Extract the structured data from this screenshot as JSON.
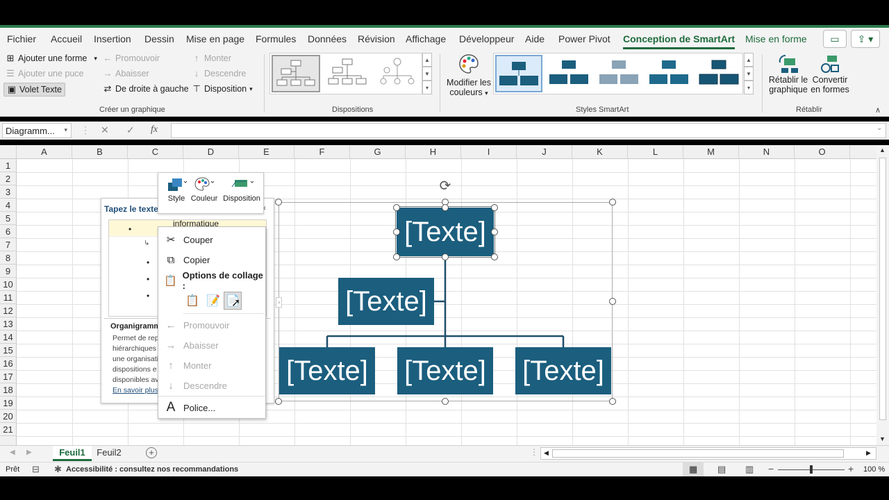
{
  "ribbon_tabs": [
    "Fichier",
    "Accueil",
    "Insertion",
    "Dessin",
    "Mise en page",
    "Formules",
    "Données",
    "Révision",
    "Affichage",
    "Développeur",
    "Aide",
    "Power Pivot",
    "Conception de SmartArt",
    "Mise en forme"
  ],
  "active_tab": "Conception de SmartArt",
  "create_graphic": {
    "add_shape": "Ajouter une forme",
    "add_bullet": "Ajouter une puce",
    "text_pane": "Volet Texte",
    "promote": "Promouvoir",
    "demote": "Abaisser",
    "right_to_left": "De droite à gauche",
    "move_up": "Monter",
    "move_down": "Descendre",
    "layout": "Disposition",
    "group_label": "Créer un graphique"
  },
  "layouts": {
    "group_label": "Dispositions"
  },
  "smartart_styles": {
    "change_colors_line1": "Modifier les",
    "change_colors_line2": "couleurs",
    "group_label": "Styles SmartArt"
  },
  "reset": {
    "reset_line1": "Rétablir le",
    "reset_line2": "graphique",
    "convert_line1": "Convertir",
    "convert_line2": "en formes",
    "group_label": "Rétablir"
  },
  "formula_bar": {
    "name_box": "Diagramm...",
    "fx_label": "fx",
    "value": ""
  },
  "columns": [
    "A",
    "B",
    "C",
    "D",
    "E",
    "F",
    "G",
    "H",
    "I",
    "J",
    "K",
    "L",
    "M",
    "N",
    "O"
  ],
  "rows": [
    "1",
    "2",
    "3",
    "4",
    "5",
    "6",
    "7",
    "8",
    "9",
    "10",
    "11",
    "12",
    "13",
    "14",
    "15",
    "16",
    "17",
    "18",
    "19",
    "20",
    "21"
  ],
  "text_pane": {
    "title": "Tapez le texte",
    "first_item": "informatique",
    "desc_title": "Organigramm",
    "desc_lines": [
      "Permet de rep",
      "hiérarchiques",
      "une organisati",
      "dispositions e",
      "disponibles av"
    ],
    "learn_more": "En savoir plus"
  },
  "mini_toolbar": {
    "style": "Style",
    "color": "Couleur",
    "layout": "Disposition"
  },
  "context_menu": {
    "cut": "Couper",
    "copy": "Copier",
    "paste_options": "Options de collage :",
    "promote": "Promouvoir",
    "demote": "Abaisser",
    "move_up": "Monter",
    "move_down": "Descendre",
    "font": "Police..."
  },
  "smartart_shapes": {
    "top": "[Texte]",
    "assistant": "[Texte]",
    "child1": "[Texte]",
    "child2": "[Texte]",
    "child3": "[Texte]"
  },
  "sheet_tabs": [
    "Feuil1",
    "Feuil2"
  ],
  "active_sheet": "Feuil1",
  "status_bar": {
    "ready": "Prêt",
    "accessibility": "Accessibilité : consultez nos recommandations",
    "zoom": "100 %",
    "zoom_level": 1.0
  },
  "colors": {
    "accent": "#1e6b3c",
    "smartart_fill": "#1b5e7e",
    "connector": "#1f4e6a"
  }
}
